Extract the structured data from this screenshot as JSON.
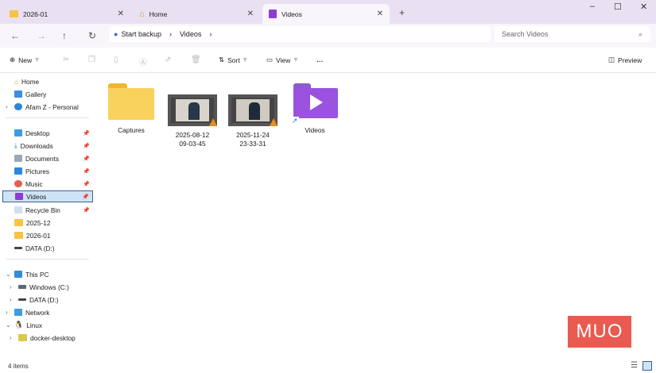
{
  "tabs": [
    {
      "label": "2026-01"
    },
    {
      "label": "Home"
    },
    {
      "label": "Videos",
      "active": true
    }
  ],
  "address": {
    "backup": "Start backup",
    "crumb": "Videos",
    "search_placeholder": "Search Videos"
  },
  "toolbar": {
    "new": "New",
    "sort": "Sort",
    "view": "View",
    "more": "…",
    "preview": "Preview"
  },
  "sidebar": {
    "items": [
      {
        "label": "Home"
      },
      {
        "label": "Gallery"
      },
      {
        "label": "Afam Z - Personal"
      },
      {
        "label": "Desktop"
      },
      {
        "label": "Downloads"
      },
      {
        "label": "Documents"
      },
      {
        "label": "Pictures"
      },
      {
        "label": "Music"
      },
      {
        "label": "Videos"
      },
      {
        "label": "Recycle Bin"
      },
      {
        "label": "2025-12"
      },
      {
        "label": "2026-01"
      },
      {
        "label": "DATA (D:)"
      },
      {
        "label": "This PC"
      },
      {
        "label": "Windows (C:)"
      },
      {
        "label": "DATA (D:)"
      },
      {
        "label": "Network"
      },
      {
        "label": "Linux"
      },
      {
        "label": "docker-desktop"
      }
    ]
  },
  "files": [
    {
      "name": "Captures"
    },
    {
      "name": "2025-08-12\n09-03-45"
    },
    {
      "name": "2025-11-24\n23-33-31"
    },
    {
      "name": "Videos"
    }
  ],
  "status": "4 items",
  "watermark": "MUO"
}
